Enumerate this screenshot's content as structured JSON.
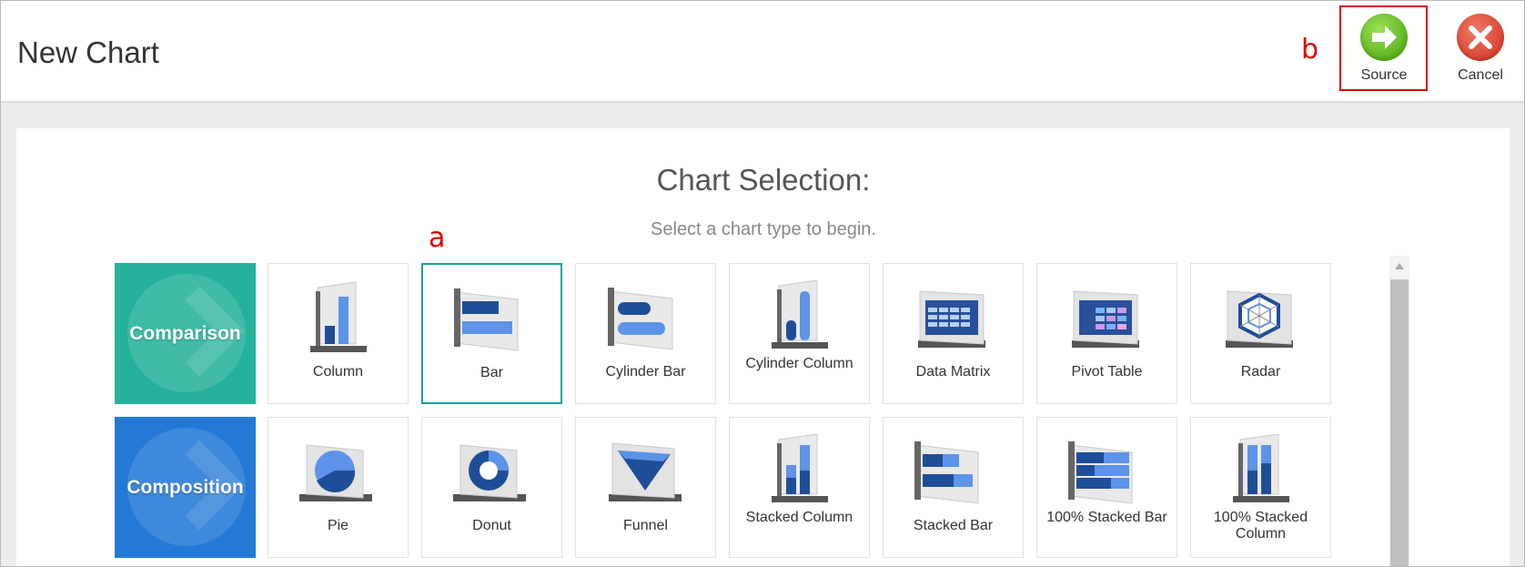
{
  "header": {
    "title": "New Chart",
    "source_label": "Source",
    "cancel_label": "Cancel"
  },
  "annotations": {
    "a": "a",
    "b": "b"
  },
  "selection": {
    "title": "Chart Selection:",
    "subtitle": "Select a chart type to begin."
  },
  "categories": [
    {
      "label": "Comparison",
      "color": "#25b19a"
    },
    {
      "label": "Composition",
      "color": "#2479d6"
    }
  ],
  "rows": [
    [
      {
        "label": "Column",
        "icon": "column-chart-icon"
      },
      {
        "label": "Bar",
        "icon": "bar-chart-icon",
        "selected": true
      },
      {
        "label": "Cylinder Bar",
        "icon": "cylinder-bar-chart-icon"
      },
      {
        "label": "Cylinder Column",
        "icon": "cylinder-column-chart-icon"
      },
      {
        "label": "Data Matrix",
        "icon": "data-matrix-icon"
      },
      {
        "label": "Pivot Table",
        "icon": "pivot-table-icon"
      },
      {
        "label": "Radar",
        "icon": "radar-chart-icon"
      }
    ],
    [
      {
        "label": "Pie",
        "icon": "pie-chart-icon"
      },
      {
        "label": "Donut",
        "icon": "donut-chart-icon"
      },
      {
        "label": "Funnel",
        "icon": "funnel-chart-icon"
      },
      {
        "label": "Stacked Column",
        "icon": "stacked-column-chart-icon"
      },
      {
        "label": "Stacked Bar",
        "icon": "stacked-bar-chart-icon"
      },
      {
        "label": "100% Stacked Bar",
        "icon": "100-stacked-bar-chart-icon"
      },
      {
        "label": "100% Stacked Column",
        "icon": "100-stacked-column-chart-icon"
      }
    ]
  ],
  "colors": {
    "accent_teal": "#25b19a",
    "accent_blue": "#2479d6",
    "highlight_red": "#e00000",
    "selected_border": "#1aa19a"
  }
}
